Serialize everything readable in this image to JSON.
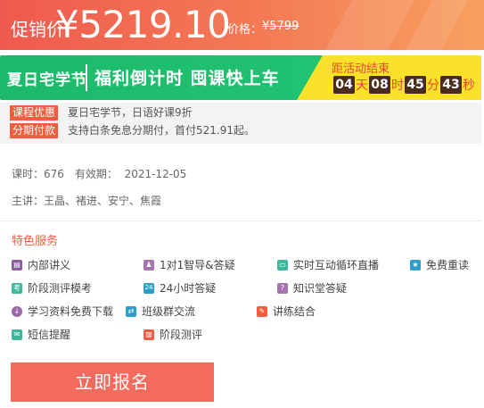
{
  "price": {
    "label": "促销价",
    "value": "¥5219.10",
    "original_label": "价格：",
    "original_value": "¥5799"
  },
  "promo": {
    "logo": "夏日宅学节",
    "slogan": "福利倒计时 囤课快上车",
    "countdown_label": "距活动结束",
    "countdown": [
      {
        "value": "04",
        "unit": "天"
      },
      {
        "value": "08",
        "unit": "时"
      },
      {
        "value": "45",
        "unit": "分"
      },
      {
        "value": "43",
        "unit": "秒"
      }
    ]
  },
  "info": {
    "rows": [
      {
        "tag": "课程优惠",
        "text": "夏日宅学节，日语好课9折"
      },
      {
        "tag": "分期付款",
        "text": "支持白条免息分期付，首付521.91起。"
      }
    ]
  },
  "meta": {
    "hours_label": "课时：676",
    "valid_label": "有效期：",
    "valid_value": "2021-12-05",
    "teachers": "主讲：王晶、褚进、安宁、焦霞"
  },
  "features": {
    "title": "特色服务",
    "items": [
      {
        "label": "内部讲义",
        "icon": "document-icon",
        "color": "#8a5d9f"
      },
      {
        "label": "1对1智导&答疑",
        "icon": "user-icon",
        "color": "#a774b2"
      },
      {
        "label": "实时互动循环直播",
        "icon": "monitor-icon",
        "color": "#3eb79a"
      },
      {
        "label": "免费重读",
        "icon": "star-icon",
        "color": "#2e9fc9"
      },
      {
        "label": "阶段测评模考",
        "icon": "exam-icon",
        "color": "#3eb79a"
      },
      {
        "label": "24小时答疑",
        "icon": "clock-24-icon",
        "color": "#2e9fc9"
      },
      {
        "label": "知识堂答疑",
        "icon": "knowledge-icon",
        "color": "#a774b2"
      },
      {
        "label": "学习资料免费下载",
        "icon": "download-icon",
        "color": "#9a6aa8"
      },
      {
        "label": "班级群交流",
        "icon": "chat-icon",
        "color": "#2e9fc9"
      },
      {
        "label": "讲练结合",
        "icon": "edit-icon",
        "color": "#f15d3e"
      },
      {
        "label": "短信提醒",
        "icon": "sms-icon",
        "color": "#3eb79a"
      },
      {
        "label": "阶段测评",
        "icon": "chart-icon",
        "color": "#f15d3e"
      }
    ]
  },
  "cta": {
    "label": "立即报名"
  }
}
